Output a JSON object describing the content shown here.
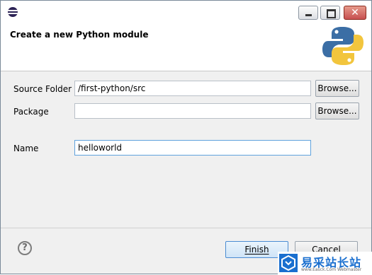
{
  "window": {
    "icon": "eclipse-icon",
    "controls": {
      "minimize": "minimize-icon",
      "maximize": "maximize-icon",
      "close": "✕"
    }
  },
  "header": {
    "title": "Create a new Python module",
    "logo": "python-logo"
  },
  "form": {
    "source_folder": {
      "label": "Source Folder",
      "value": "/first-python/src",
      "browse": "Browse..."
    },
    "package": {
      "label": "Package",
      "value": "",
      "browse": "Browse..."
    },
    "name": {
      "label": "Name",
      "value": "helloworld"
    }
  },
  "footer": {
    "help": "?",
    "finish": "Finish",
    "cancel": "Cancel"
  },
  "watermark": {
    "text": "易采站长站",
    "subtext": "www.Easck.Com Webmaster"
  },
  "colors": {
    "python_blue": "#3b6ea5",
    "python_yellow": "#f2c53d",
    "focus_border": "#5fa2dd",
    "watermark_blue": "#1a6fcf"
  }
}
